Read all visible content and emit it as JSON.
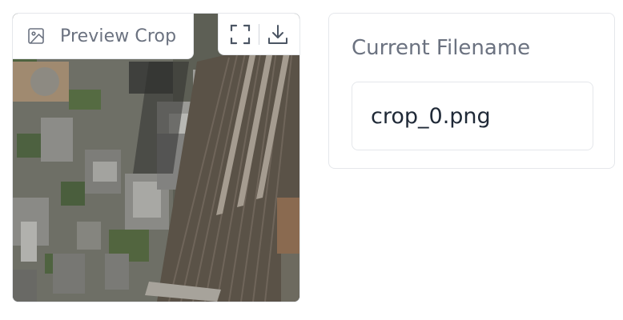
{
  "image_panel": {
    "label": "Preview Crop",
    "label_icon": "image-icon",
    "tools": [
      {
        "name": "fullscreen-icon"
      },
      {
        "name": "download-icon"
      }
    ]
  },
  "filename_panel": {
    "label": "Current Filename",
    "value": "crop_0.png"
  }
}
